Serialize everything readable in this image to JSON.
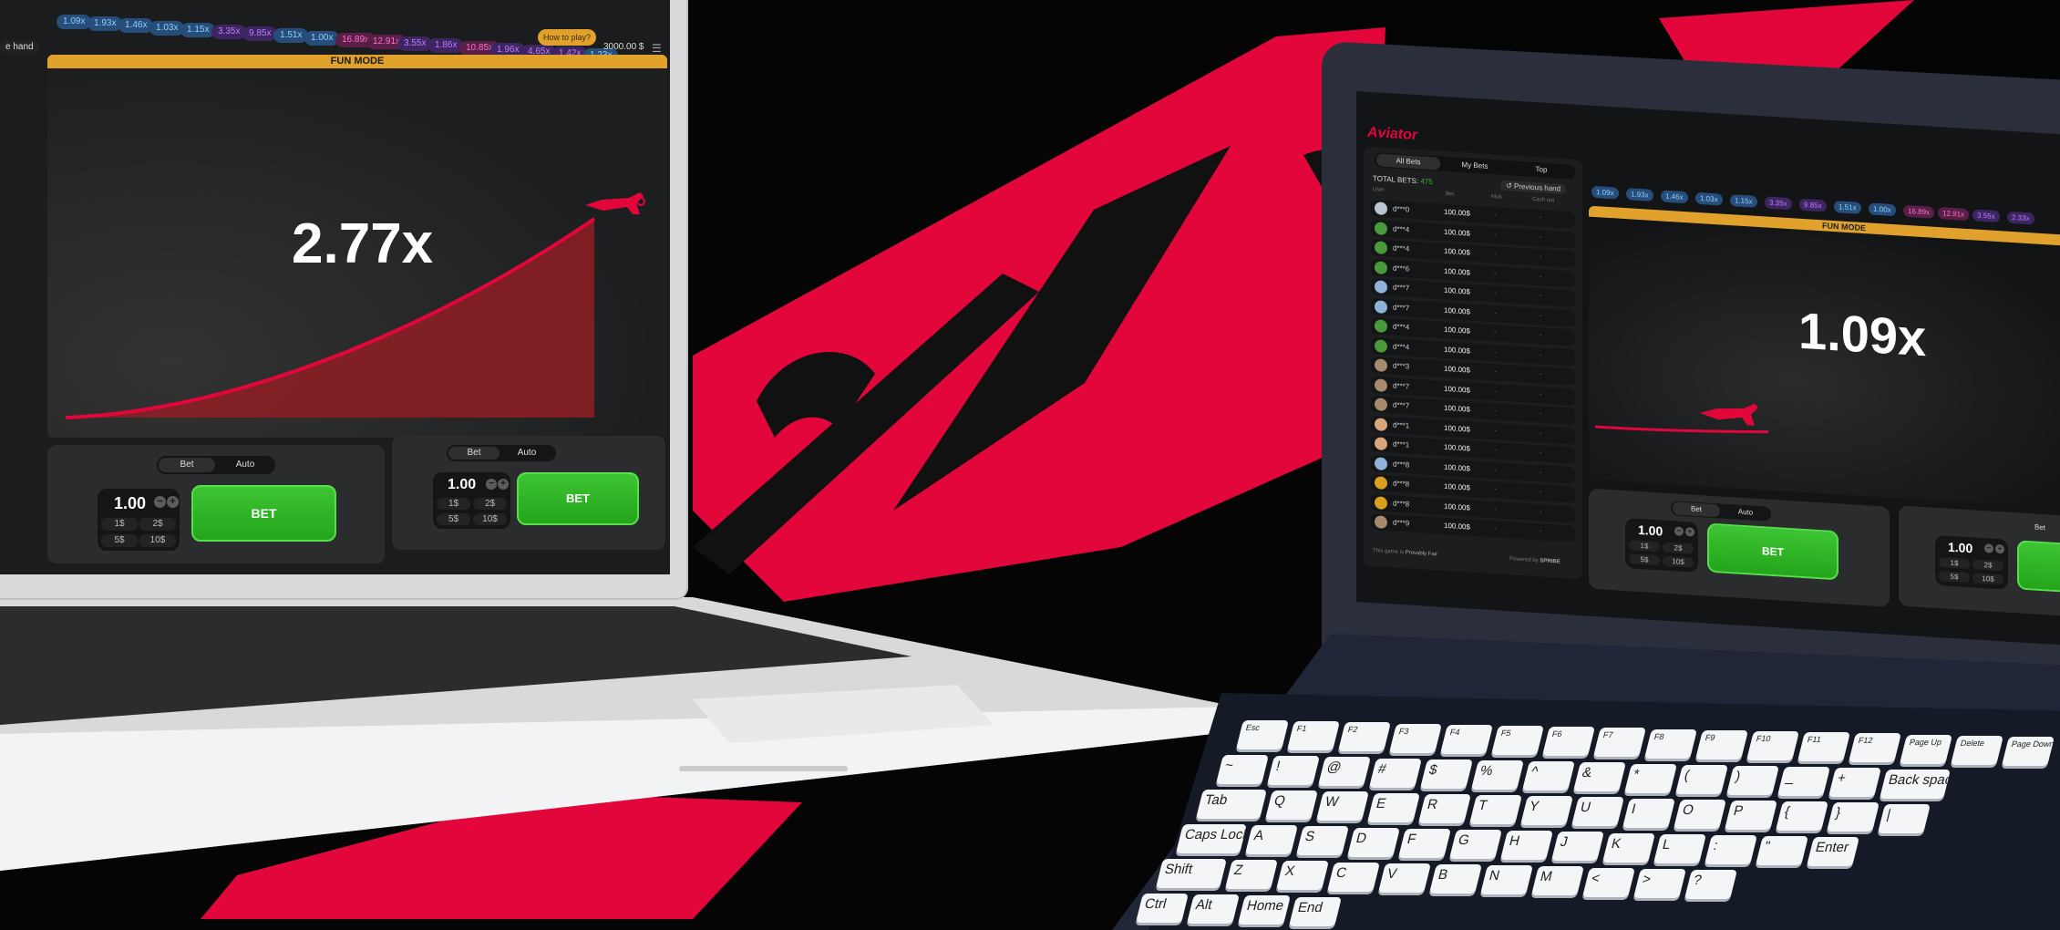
{
  "left_game": {
    "history_multipliers": [
      "1.09x",
      "1.93x",
      "1.46x",
      "1.03x",
      "1.15x",
      "3.35x",
      "9.85x",
      "1.51x",
      "1.00x",
      "16.89x",
      "12.91x",
      "3.55x",
      "1.86x",
      "10.85x",
      "1.96x",
      "4.65x",
      "1.42x",
      "1.23x"
    ],
    "how_to_play": "How to play?",
    "balance": "3000.00 $",
    "fun_mode": "FUN MODE",
    "multiplier": "2.77x",
    "sidebar_partial": "e hand",
    "panels": [
      {
        "tab_bet": "Bet",
        "tab_auto": "Auto",
        "amount": "1.00",
        "chips": [
          "1$",
          "2$",
          "5$",
          "10$"
        ],
        "bet_label": "BET"
      },
      {
        "tab_bet": "Bet",
        "tab_auto": "Auto",
        "amount": "1.00",
        "chips": [
          "1$",
          "2$",
          "5$",
          "10$"
        ],
        "bet_label": "BET"
      }
    ]
  },
  "right_game": {
    "logo": "Aviator",
    "tabs": [
      "All Bets",
      "My Bets",
      "Top"
    ],
    "total_bets_label": "TOTAL BETS:",
    "total_bets_value": "475",
    "previous_hand": "Previous hand",
    "columns": [
      "User",
      "Bet",
      "Mult.",
      "Cash out"
    ],
    "rows": [
      {
        "user": "d***0",
        "bet": "100.00$"
      },
      {
        "user": "d***4",
        "bet": "100.00$"
      },
      {
        "user": "d***4",
        "bet": "100.00$"
      },
      {
        "user": "d***6",
        "bet": "100.00$"
      },
      {
        "user": "d***7",
        "bet": "100.00$"
      },
      {
        "user": "d***7",
        "bet": "100.00$"
      },
      {
        "user": "d***4",
        "bet": "100.00$"
      },
      {
        "user": "d***4",
        "bet": "100.00$"
      },
      {
        "user": "d***3",
        "bet": "100.00$"
      },
      {
        "user": "d***7",
        "bet": "100.00$"
      },
      {
        "user": "d***7",
        "bet": "100.00$"
      },
      {
        "user": "d***1",
        "bet": "100.00$"
      },
      {
        "user": "d***1",
        "bet": "100.00$"
      },
      {
        "user": "d***8",
        "bet": "100.00$"
      },
      {
        "user": "d***8",
        "bet": "100.00$"
      },
      {
        "user": "d***8",
        "bet": "100.00$"
      },
      {
        "user": "d***9",
        "bet": "100.00$"
      }
    ],
    "row_dash": "-",
    "history_multipliers": [
      "1.09x",
      "1.93x",
      "1.46x",
      "1.03x",
      "1.15x",
      "3.35x",
      "9.85x",
      "1.51x",
      "1.00x",
      "16.89x",
      "12.91x",
      "3.55x",
      "2.33x"
    ],
    "fun_mode": "FUN MODE",
    "multiplier": "1.09x",
    "footer_left": "This game is",
    "footer_provably": "Provably Fair",
    "footer_powered": "Powered by",
    "footer_brand": "SPRIBE",
    "panels": [
      {
        "tab_bet": "Bet",
        "tab_auto": "Auto",
        "amount": "1.00",
        "chips": [
          "1$",
          "2$",
          "5$",
          "10$"
        ],
        "bet_label": "BET"
      },
      {
        "tab_bet": "Bet",
        "amount": "1.00",
        "chips": [
          "1$",
          "2$",
          "5$",
          "10$"
        ]
      }
    ]
  },
  "keyboard": {
    "row1": [
      "Esc",
      "F1",
      "F2",
      "F3",
      "F4",
      "F5",
      "F6",
      "F7",
      "F8",
      "F9",
      "F10",
      "F11",
      "F12",
      "Page Up",
      "Delete",
      "Page Down"
    ],
    "row2": [
      "~",
      "!",
      "@",
      "#",
      "$",
      "%",
      "^",
      "&",
      "*",
      "(",
      ")",
      "_",
      "+",
      "Back space"
    ],
    "row3": [
      "Tab",
      "Q",
      "W",
      "E",
      "R",
      "T",
      "Y",
      "U",
      "I",
      "O",
      "P",
      "{",
      "}",
      "|"
    ],
    "row4": [
      "Caps Lock",
      "A",
      "S",
      "D",
      "F",
      "G",
      "H",
      "J",
      "K",
      "L",
      ":",
      "\"",
      "Enter"
    ],
    "row5": [
      "Shift",
      "Z",
      "X",
      "C",
      "V",
      "B",
      "N",
      "M",
      "<",
      ">",
      "?"
    ],
    "row6": [
      "Ctrl",
      "Alt",
      "Home",
      "End"
    ]
  },
  "colors": {
    "brand_red": "#e2063b",
    "bet_green": "#2fb826",
    "fun_mode_orange": "#e0a22c",
    "background": "#050505"
  }
}
